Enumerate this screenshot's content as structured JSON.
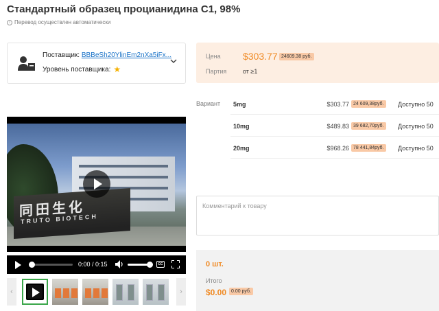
{
  "product": {
    "title": "Стандартный образец процианидина C1, 98%",
    "auto_translated": "Перевод осуществлен автоматически"
  },
  "supplier": {
    "label": "Поставщик:",
    "name": "BBBeSh20YlinEm2nXa5iFx...",
    "level_label": "Уровень поставщика:"
  },
  "price_box": {
    "price_label": "Цена",
    "price": "$303.77",
    "price_rub": "24609.38 руб.",
    "batch_label": "Партия",
    "batch_value": "от ≥1"
  },
  "variants": {
    "label": "Вариант",
    "rows": [
      {
        "name": "5mg",
        "price": "$303.77",
        "rub": "24 609,38руб.",
        "avail": "Доступно 50"
      },
      {
        "name": "10mg",
        "price": "$489.83",
        "rub": "39 682,70руб.",
        "avail": "Доступно 50"
      },
      {
        "name": "20mg",
        "price": "$968.26",
        "rub": "78 441,84руб.",
        "avail": "Доступно 50"
      }
    ]
  },
  "video": {
    "sign_text": "同田生化",
    "sign_sub": "TRUTO BIOTECH",
    "time": "0:00 / 0:15",
    "cc": "CC"
  },
  "thumbnails": {
    "prev": "‹",
    "next": "›"
  },
  "comment": {
    "placeholder": "Комментарий к товару"
  },
  "summary": {
    "quantity": "0 шт.",
    "total_label": "Итого",
    "total": "$0.00",
    "total_rub": "0.00 руб."
  },
  "colors": {
    "accent": "#f08a24",
    "price_bg": "#fdeee2",
    "badge_bg": "#f9c9a6",
    "link": "#1a73c8",
    "thumb_active": "#3aa64a"
  }
}
